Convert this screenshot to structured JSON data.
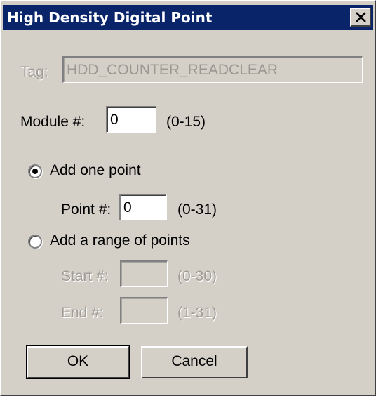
{
  "window": {
    "title": "High Density Digital Point"
  },
  "tag": {
    "label": "Tag:",
    "value": "HDD_COUNTER_READCLEAR"
  },
  "module": {
    "label": "Module #:",
    "value": "0",
    "range": "(0-15)"
  },
  "add_one_point": {
    "label": "Add one point",
    "selected": true,
    "point_label": "Point #:",
    "point_value": "0",
    "point_range": "(0-31)"
  },
  "add_range": {
    "label": "Add a range of points",
    "selected": false,
    "start_label": "Start #:",
    "start_value": "",
    "start_range": "(0-30)",
    "end_label": "End #:",
    "end_value": "",
    "end_range": "(1-31)"
  },
  "buttons": {
    "ok": "OK",
    "cancel": "Cancel"
  },
  "colors": {
    "titlebar": "#0a246a",
    "face": "#d4d0c8",
    "disabled_text": "#a09d96"
  },
  "icons": {
    "close": "close-icon",
    "radio_selected": "radio-selected-icon",
    "radio_unselected": "radio-unselected-icon"
  }
}
